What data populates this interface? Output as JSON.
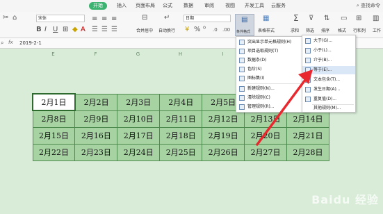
{
  "tabs": [
    {
      "label": "开始",
      "active": true
    },
    {
      "label": "插入"
    },
    {
      "label": "页面布局"
    },
    {
      "label": "公式"
    },
    {
      "label": "数据"
    },
    {
      "label": "审阅"
    },
    {
      "label": "视图"
    },
    {
      "label": "开发工具"
    },
    {
      "label": "云服务"
    }
  ],
  "search_label": "查找命令",
  "ribbon": {
    "font_name": "宋体",
    "number_format": "日期",
    "merge_label": "合并居中",
    "wrap_label": "自动换行",
    "cond_format_label": "条件格式",
    "table_style_label": "表格样式",
    "sum_label": "求和",
    "filter_label": "筛选",
    "sort_label": "排序",
    "format_label": "格式",
    "rowcol_label": "行和列",
    "worksheet_label": "工作"
  },
  "formula_bar": {
    "fx": "fx",
    "value": "2019-2-1"
  },
  "columns": [
    "E",
    "F",
    "G",
    "H",
    "I"
  ],
  "table": [
    [
      "2月1日",
      "2月2日",
      "2月3日",
      "2月4日",
      "2月5日",
      "",
      ""
    ],
    [
      "2月8日",
      "2月9日",
      "2月10日",
      "2月11日",
      "2月12日",
      "2月13日",
      "2月14日"
    ],
    [
      "2月15日",
      "2月16日",
      "2月17日",
      "2月18日",
      "2月19日",
      "2月20日",
      "2月21日"
    ],
    [
      "2月22日",
      "2月23日",
      "2月24日",
      "2月25日",
      "2月26日",
      "2月27日",
      "2月28日"
    ]
  ],
  "menu_main": [
    {
      "label": "突出显示单元格规则(H)",
      "arrow": "▸"
    },
    {
      "label": "项目选取规则(T)",
      "arrow": "▸"
    },
    {
      "label": "数据条(D)",
      "arrow": "▸"
    },
    {
      "label": "色阶(S)",
      "arrow": "▸"
    },
    {
      "label": "图标集(I)",
      "arrow": "▸"
    },
    {
      "label": "新建规则(N)..."
    },
    {
      "label": "清除规则(C)",
      "arrow": "▸"
    },
    {
      "label": "管理规则(R)..."
    }
  ],
  "menu_sub": [
    {
      "label": "大于(G)..."
    },
    {
      "label": "小于(L)..."
    },
    {
      "label": "介于(B)..."
    },
    {
      "label": "等于(E)...",
      "highlight": true
    },
    {
      "label": "文本包含(T)..."
    },
    {
      "label": "发生日期(A)..."
    },
    {
      "label": "重复值(D)..."
    },
    {
      "label": "其他规则(M)..."
    }
  ],
  "watermark": "Baidu 经验"
}
